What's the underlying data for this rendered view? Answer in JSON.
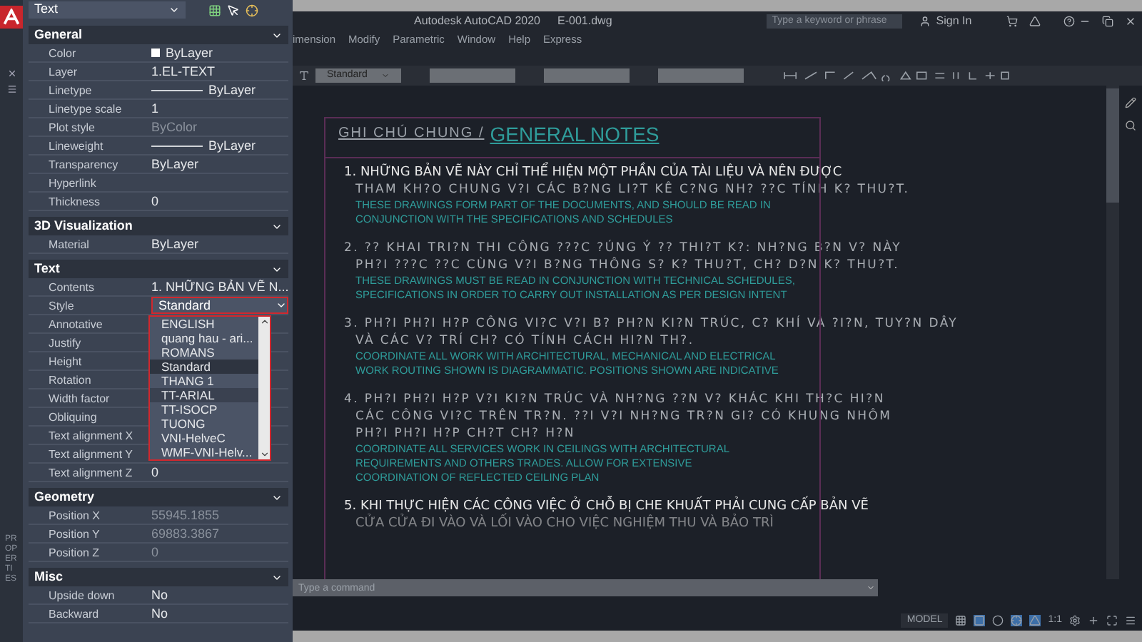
{
  "window": {
    "title": "Autodesk AutoCAD 2020",
    "file": "E-001.dwg"
  },
  "search": {
    "placeholder": "Type a keyword or phrase"
  },
  "sign_in": "Sign In",
  "menu": [
    "imension",
    "Modify",
    "Parametric",
    "Window",
    "Help",
    "Express"
  ],
  "toolbar": {
    "text_style": "Standard"
  },
  "palette": {
    "object_type": "Text",
    "title": "PROPERTIES",
    "sections": [
      {
        "name": "General",
        "expanded": true,
        "rows": [
          {
            "label": "Color",
            "value": "ByLayer",
            "kind": "color"
          },
          {
            "label": "Layer",
            "value": "1.EL-TEXT",
            "kind": "text"
          },
          {
            "label": "Linetype",
            "value": "ByLayer",
            "kind": "line"
          },
          {
            "label": "Linetype scale",
            "value": "1",
            "kind": "text"
          },
          {
            "label": "Plot style",
            "value": "ByColor",
            "kind": "disabled"
          },
          {
            "label": "Lineweight",
            "value": "ByLayer",
            "kind": "line"
          },
          {
            "label": "Transparency",
            "value": "ByLayer",
            "kind": "text"
          },
          {
            "label": "Hyperlink",
            "kind": "text"
          },
          {
            "label": "Thickness",
            "value": "0",
            "kind": "text"
          }
        ]
      },
      {
        "name": "3D Visualization",
        "expanded": true,
        "rows": [
          {
            "label": "Material",
            "value": "ByLayer",
            "kind": "text"
          }
        ]
      },
      {
        "name": "Text",
        "expanded": true,
        "rows": [
          {
            "label": "Contents",
            "value": "1. NHỮNG BẢN VẼ N...",
            "kind": "text"
          },
          {
            "label": "Style",
            "value": "Standard",
            "kind": "dropdown",
            "open": true,
            "options": [
              {
                "label": "ENGLISH",
                "selected": false,
                "hovered": false
              },
              {
                "label": "quang hau - ari...",
                "selected": false,
                "hovered": false
              },
              {
                "label": "ROMANS",
                "selected": false,
                "hovered": false
              },
              {
                "label": "Standard",
                "selected": true,
                "hovered": false
              },
              {
                "label": "THANG 1",
                "selected": false,
                "hovered": false
              },
              {
                "label": "TT-ARIAL",
                "selected": false,
                "hovered": true
              },
              {
                "label": "TT-ISOCP",
                "selected": false,
                "hovered": false
              },
              {
                "label": "TUONG",
                "selected": false,
                "hovered": false
              },
              {
                "label": "VNI-HelveC",
                "selected": false,
                "hovered": false
              },
              {
                "label": "WMF-VNI-Helv...",
                "selected": false,
                "hovered": false
              }
            ]
          },
          {
            "label": "Annotative",
            "kind": "text"
          },
          {
            "label": "Justify",
            "kind": "text"
          },
          {
            "label": "Height",
            "kind": "text"
          },
          {
            "label": "Rotation",
            "kind": "text"
          },
          {
            "label": "Width factor",
            "kind": "text"
          },
          {
            "label": "Obliquing",
            "kind": "text"
          },
          {
            "label": "Text alignment X",
            "kind": "text"
          },
          {
            "label": "Text alignment Y",
            "kind": "text"
          },
          {
            "label": "Text alignment Z",
            "value": "0",
            "kind": "text"
          }
        ]
      },
      {
        "name": "Geometry",
        "expanded": true,
        "rows": [
          {
            "label": "Position X",
            "value": "55945.1855",
            "kind": "disabled"
          },
          {
            "label": "Position Y",
            "value": "69883.3867",
            "kind": "disabled"
          },
          {
            "label": "Position Z",
            "value": "0",
            "kind": "disabled"
          }
        ]
      },
      {
        "name": "Misc",
        "expanded": true,
        "rows": [
          {
            "label": "Upside down",
            "value": "No",
            "kind": "text"
          },
          {
            "label": "Backward",
            "value": "No",
            "kind": "text"
          }
        ]
      }
    ]
  },
  "drawing": {
    "heading_vi": "GHI CHÚ CHUNG /",
    "heading_en": "GENERAL NOTES",
    "notes": [
      {
        "lines": [
          {
            "kind": "unicode",
            "text": "1. NHỮNG BẢN VẼ NÀY CHỈ THỂ HIỆN MỘT PHẦN CỦA TÀI  LIỆU VÀ NÊN ĐƯỢC"
          },
          {
            "kind": "shx",
            "text": "THAM KH?O CHUNG V?I CÁC B?NG LI?T KÊ C?NG NH? ??C TÍNH K? THU?T."
          }
        ],
        "english": [
          "THESE DRAWINGS FORM PART OF THE DOCUMENTS, AND SHOULD BE READ IN",
          "CONJUNCTION WITH THE SPECIFICATIONS AND SCHEDULES"
        ]
      },
      {
        "lines": [
          {
            "kind": "shx",
            "text": "2. ?? KHAI TRI?N THI CÔNG ???C ?ÚNG Ý ?? THI?T K?: NH?NG B?N V? NÀY"
          },
          {
            "kind": "shx",
            "text": "PH?I ???C ??C CÙNG V?I B?NG THÔNG S? K? THU?T, CH? D?N K? THU?T."
          }
        ],
        "english": [
          "THESE DRAWINGS MUST BE READ IN CONJUNCTION WITH TECHNICAL SCHEDULES,",
          "SPECIFICATIONS IN ORDER TO CARRY OUT INSTALLATION AS PER DESIGN INTENT"
        ]
      },
      {
        "lines": [
          {
            "kind": "shx",
            "text": "3. PH?I PH?I H?P CÔNG VI?C V?I B? PH?N KI?N TRÚC, C? KHÍ VÀ ?I?N, TUY?N DÂY"
          },
          {
            "kind": "shx",
            "text": "VÀ CÁC V? TRÍ CH? CÓ TÍNH CÁCH HI?N TH?."
          }
        ],
        "english": [
          "COORDINATE ALL WORK WITH ARCHITECTURAL, MECHANICAL AND ELECTRICAL",
          "WORK ROUTING SHOWN IS DIAGRAMMATIC. POSITIONS SHOWN ARE INDICATIVE"
        ]
      },
      {
        "lines": [
          {
            "kind": "shx",
            "text": "4. PH?I PH?I H?P V?I KI?N TRÚC VÀ NH?NG ??N V? KHÁC KHI TH?C HI?N"
          },
          {
            "kind": "shx",
            "text": "CÁC CÔNG VI?C TRÊN TR?N. ??I V?I NH?NG TR?N GI? CÓ KHUNG NHÔM"
          },
          {
            "kind": "shx",
            "text": "PH?I PH?I H?P CH?T CH? H?N"
          }
        ],
        "english": [
          "COORDINATE ALL SERVICES WORK IN CEILINGS WITH ARCHITECTURAL",
          "REQUIREMENTS AND OTHERS TRADES. ALLOW FOR EXTENSIVE",
          "COORDINATION OF REFLECTED CEILING PLAN"
        ]
      },
      {
        "lines": [
          {
            "kind": "unicode",
            "text": "5. KHI THỰC HIỆN CÁC CÔNG VIỆC Ở CHỖ BỊ CHE KHUẤT PHẢI CUNG CẤP BẢN VẼ"
          },
          {
            "kind": "unicode",
            "text": "CỬA CỬA ĐI VÀO VÀ LỐI VÀO CHO VIỆC NGHIỆM THU VÀ BẢO TRÌ"
          }
        ]
      }
    ]
  },
  "command_line": {
    "placeholder": "Type a command"
  },
  "status_bar": {
    "model": "MODEL",
    "scale": "1:1"
  }
}
